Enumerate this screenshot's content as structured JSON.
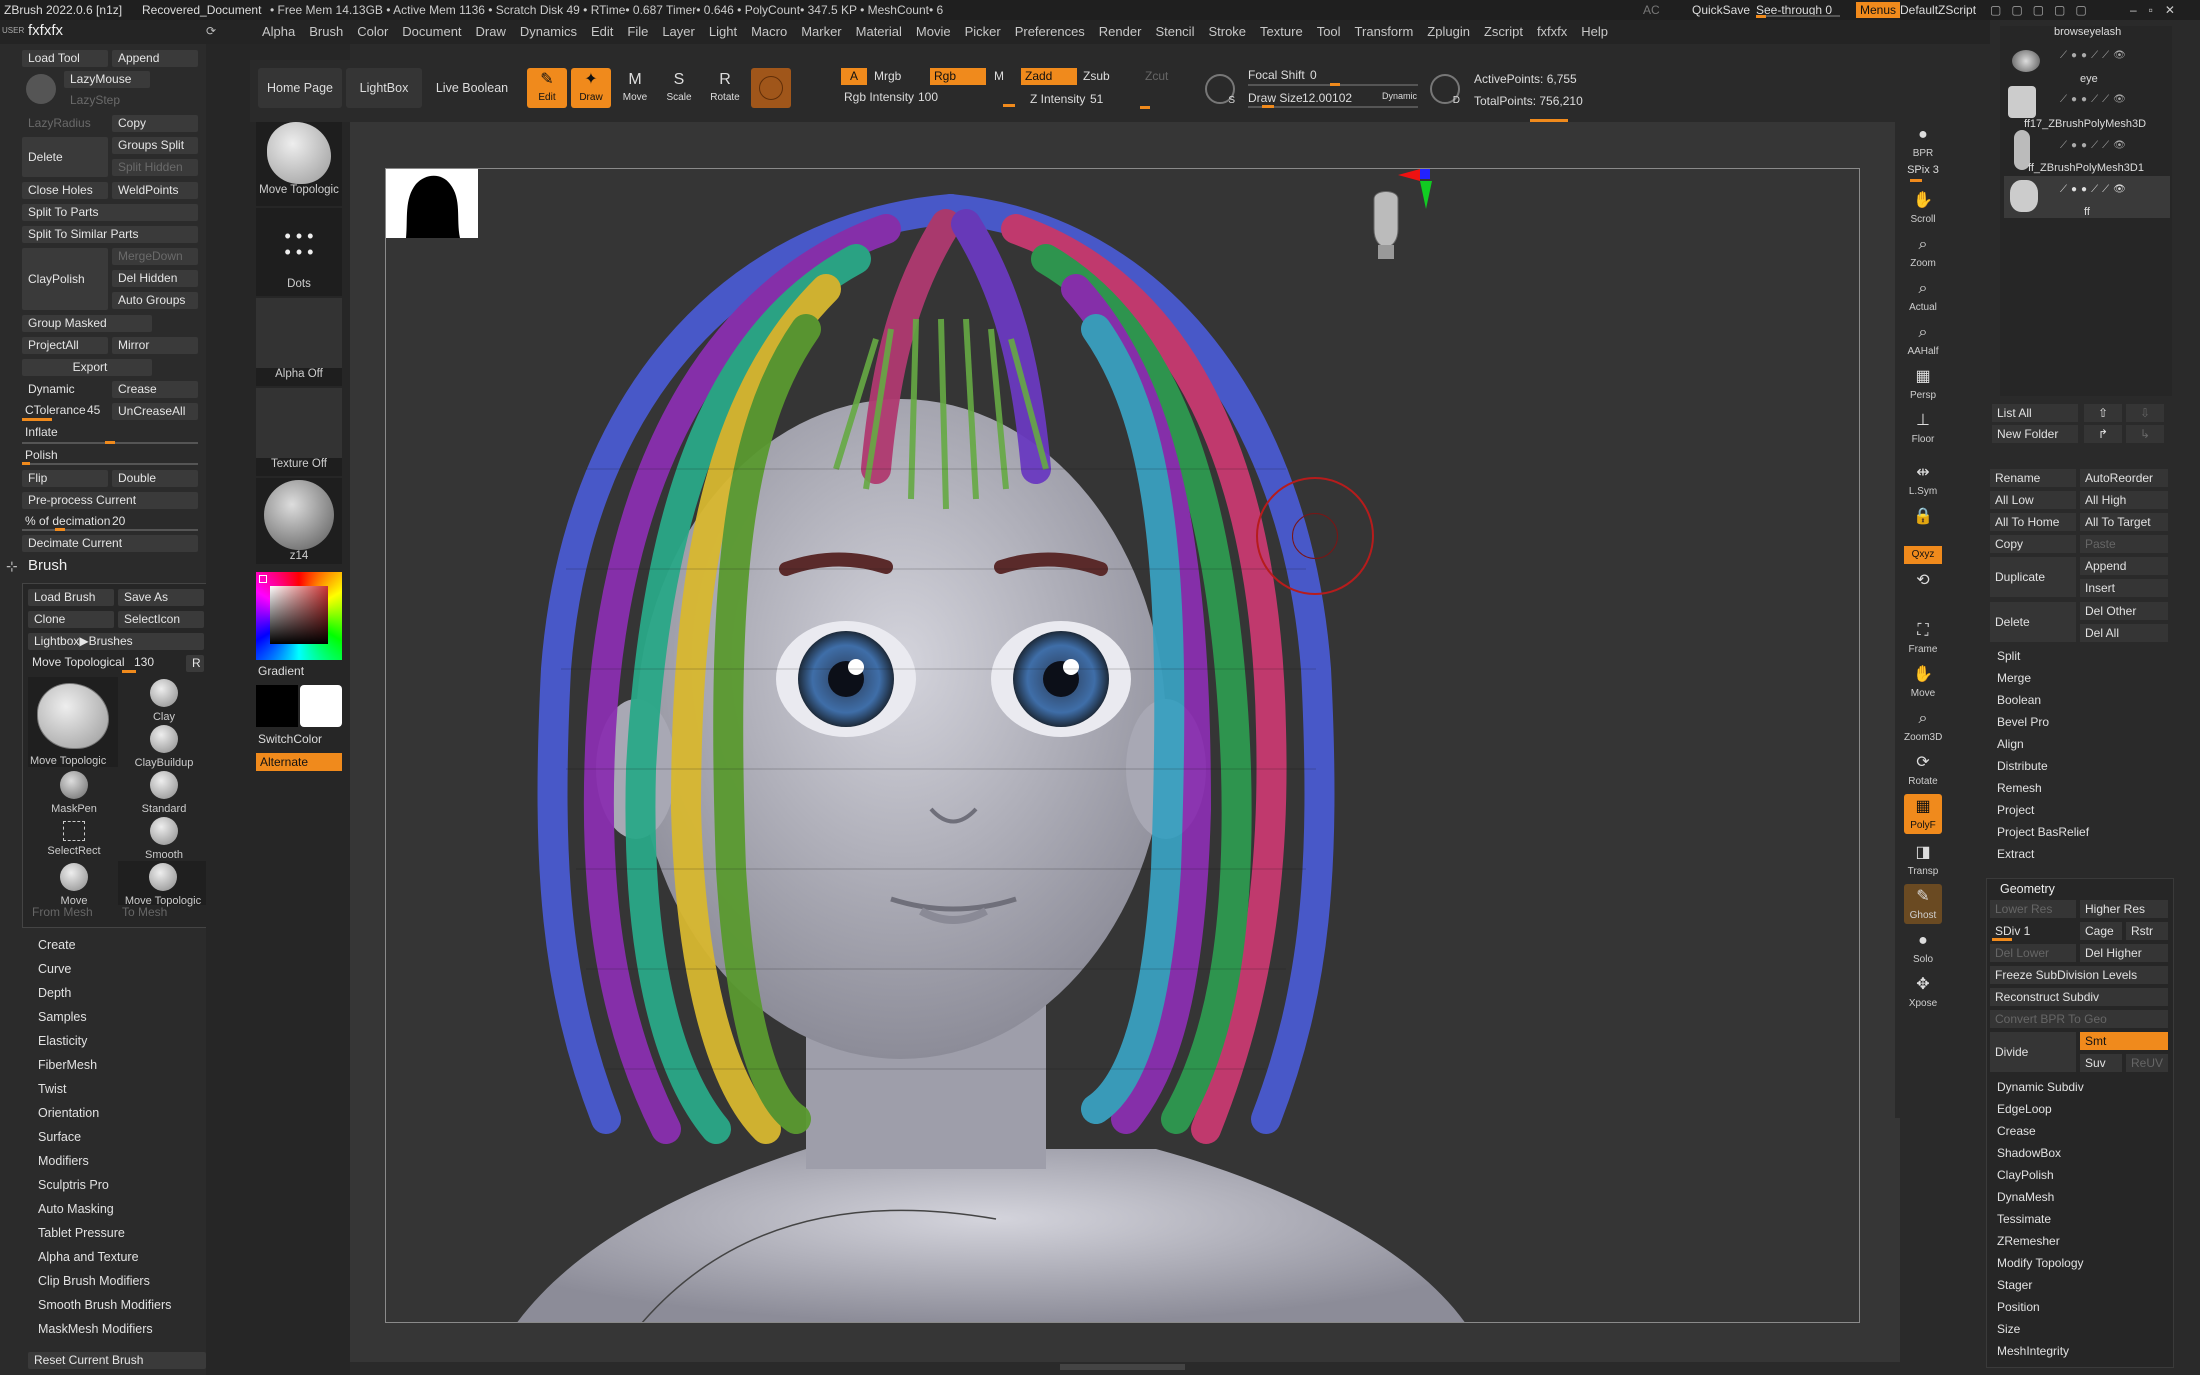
{
  "app": {
    "title": "ZBrush 2022.0.6 [n1z]",
    "document": "Recovered_Document",
    "status": "• Free Mem 14.13GB • Active Mem 1136 • Scratch Disk 49 • RTime• 0.687 Timer• 0.646 • PolyCount• 347.5 KP • MeshCount• 6",
    "ac": "AC",
    "quicksave": "QuickSave",
    "seethrough": "See-through  0",
    "menus": "Menus",
    "zscript": "DefaultZScript"
  },
  "menu": [
    "Alpha",
    "Brush",
    "Color",
    "Document",
    "Draw",
    "Dynamics",
    "Edit",
    "File",
    "Layer",
    "Light",
    "Macro",
    "Marker",
    "Material",
    "Movie",
    "Picker",
    "Preferences",
    "Render",
    "Stencil",
    "Stroke",
    "Texture",
    "Tool",
    "Transform",
    "Zplugin",
    "Zscript",
    "fxfxfx",
    "Help"
  ],
  "left": {
    "user": "USER",
    "palette_title": "fxfxfx",
    "load_tool": "Load Tool",
    "append": "Append",
    "lazymouse": "LazyMouse",
    "lazystep": "LazyStep",
    "lazyradius": "LazyRadius",
    "copy": "Copy",
    "delete": "Delete",
    "groups_split": "Groups Split",
    "split_hidden": "Split Hidden",
    "close_holes": "Close Holes",
    "weldpoints": "WeldPoints",
    "split_to_parts": "Split To Parts",
    "split_similar": "Split To Similar Parts",
    "mergedown": "MergeDown",
    "claypolish": "ClayPolish",
    "del_hidden": "Del Hidden",
    "auto_groups": "Auto Groups",
    "group_masked": "Group Masked",
    "projectall": "ProjectAll",
    "mirror": "Mirror",
    "export": "Export",
    "dynamic": "Dynamic",
    "crease": "Crease",
    "ctolerance": "CTolerance",
    "ctolerance_val": "45",
    "uncreaseall": "UnCreaseAll",
    "inflate": "Inflate",
    "polish": "Polish",
    "flip": "Flip",
    "double": "Double",
    "preprocess": "Pre-process Current",
    "decimation": "% of decimation",
    "decimation_val": "20",
    "decimate_current": "Decimate Current",
    "brush_title": "Brush",
    "load_brush": "Load Brush",
    "save_as": "Save As",
    "clone": "Clone",
    "selecticon": "SelectIcon",
    "lightbox_brushes": "Lightbox▶Brushes",
    "move_topo_label": "Move Topological",
    "move_topo_val": "130",
    "r": "R",
    "brushes": [
      "Move Topologic",
      "Clay",
      "ClayBuildup",
      "MaskPen",
      "Standard",
      "SelectRect",
      "Smooth",
      "Move",
      "Move Topologic"
    ],
    "from_mesh": "From Mesh",
    "to_mesh": "To Mesh",
    "subpalettes": [
      "Create",
      "Curve",
      "Depth",
      "Samples",
      "Elasticity",
      "FiberMesh",
      "Twist",
      "Orientation",
      "Surface",
      "Modifiers",
      "Sculptris Pro",
      "Auto Masking",
      "Tablet Pressure",
      "Alpha and Texture",
      "Clip Brush Modifiers",
      "Smooth Brush Modifiers",
      "MaskMesh Modifiers"
    ],
    "reset_brush": "Reset Current Brush"
  },
  "middle": {
    "brush_tile": "Move Topologic",
    "stroke_tile": "Dots",
    "alpha_tile": "Alpha Off",
    "texture_tile": "Texture Off",
    "material_tile": "z14",
    "gradient": "Gradient",
    "switchcolor": "SwitchColor",
    "alternate": "Alternate"
  },
  "toolbar": {
    "home": "Home Page",
    "lightbox": "LightBox",
    "liveboolean": "Live Boolean",
    "edit": "Edit",
    "draw": "Draw",
    "move": "Move",
    "scale": "Scale",
    "rotate": "Rotate",
    "a": "A",
    "mrgb": "Mrgb",
    "rgb": "Rgb",
    "m": "M",
    "zadd": "Zadd",
    "zsub": "Zsub",
    "zcut": "Zcut",
    "rgb_intensity": "Rgb Intensity",
    "rgb_intensity_val": "100",
    "z_intensity": "Z Intensity",
    "z_intensity_val": "51",
    "focal_shift": "Focal Shift",
    "focal_shift_val": "0",
    "draw_size": "Draw Size",
    "draw_size_val": "12.00102",
    "dynamic": "Dynamic",
    "active_points": "ActivePoints: 6,755",
    "total_points": "TotalPoints: 756,210",
    "s": "S",
    "d": "D"
  },
  "shelf": [
    "BPR",
    "SPix 3",
    "Scroll",
    "Zoom",
    "Actual",
    "AAHalf",
    "Persp",
    "Floor",
    "L.Sym",
    "",
    "Qxyz",
    "Frame",
    "Move",
    "Zoom3D",
    "Rotate",
    "PolyF",
    "Transp",
    "Ghost",
    "Solo",
    "Xpose"
  ],
  "right": {
    "subtools": [
      "browseyelash",
      "eye",
      "ff17_ZBrushPolyMesh3D",
      "ff_ZBrushPolyMesh3D1",
      "ff"
    ],
    "list_all": "List All",
    "new_folder": "New Folder",
    "rename": "Rename",
    "autoreorder": "AutoReorder",
    "all_low": "All Low",
    "all_high": "All High",
    "all_to_home": "All To Home",
    "all_to_target": "All To Target",
    "copy": "Copy",
    "paste": "Paste",
    "duplicate": "Duplicate",
    "append": "Append",
    "insert": "Insert",
    "delete": "Delete",
    "del_other": "Del Other",
    "del_all": "Del All",
    "list1": [
      "Split",
      "Merge",
      "Boolean",
      "Bevel Pro",
      "Align",
      "Distribute",
      "Remesh",
      "Project",
      "Project BasRelief",
      "Extract"
    ],
    "geometry": "Geometry",
    "lower_res": "Lower Res",
    "higher_res": "Higher Res",
    "sdiv": "SDiv 1",
    "cage": "Cage",
    "rstr": "Rstr",
    "del_lower": "Del Lower",
    "del_higher": "Del Higher",
    "freeze": "Freeze SubDivision Levels",
    "reconstruct": "Reconstruct Subdiv",
    "convert_bpr": "Convert BPR To Geo",
    "divide": "Divide",
    "smt": "Smt",
    "suv": "Suv",
    "reuv": "ReUV",
    "list2": [
      "Dynamic Subdiv",
      "EdgeLoop",
      "Crease",
      "ShadowBox",
      "ClayPolish",
      "DynaMesh",
      "Tessimate",
      "ZRemesher",
      "Modify Topology",
      "Stager",
      "Position",
      "Size",
      "MeshIntegrity"
    ]
  },
  "colors": {
    "accent": "#f08a1c",
    "panel": "#2b2b2b",
    "button": "#3a3a3a",
    "viewport": "#363636"
  }
}
